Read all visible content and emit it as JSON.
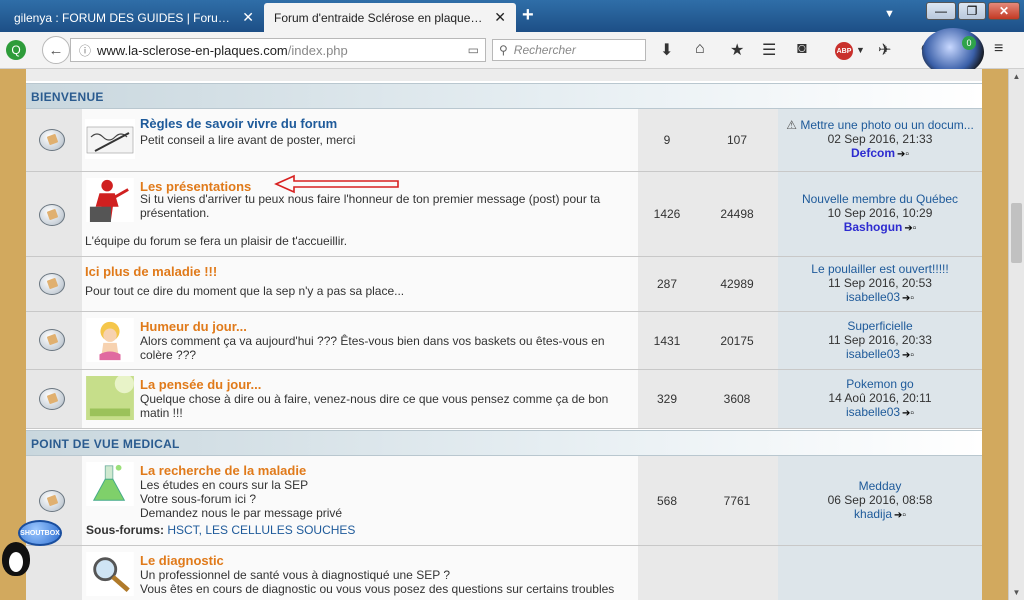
{
  "browser": {
    "tabs": [
      {
        "label": "gilenya : FORUM DES GUIDES | Forum ...",
        "active": false
      },
      {
        "label": "Forum d'entraide Sclérose en plaques (...",
        "active": true
      }
    ],
    "url_host": "www.la-sclerose-en-plaques.com",
    "url_path": "/index.php",
    "search_placeholder": "Rechercher",
    "badge_count": "0",
    "abp_label": "ABP"
  },
  "forum": {
    "top_cut_text": "…",
    "categories": [
      {
        "label": "BIENVENUE"
      },
      {
        "label": "POINT DE VUE MEDICAL"
      }
    ],
    "rows": [
      {
        "title": "Règles de savoir vivre du forum",
        "desc": "Petit conseil a lire avant de poster, merci",
        "topics": "9",
        "posts": "107",
        "last_title": "Mettre une photo ou un docum...",
        "last_date": "02 Sep 2016, 21:33",
        "last_user": "Defcom"
      },
      {
        "title": "Les présentations",
        "desc1": "Si tu viens d'arriver tu peux nous faire l'honneur de ton premier message (post) pour ta",
        "desc2": "présentation.",
        "desc3": "L'équipe du forum se fera un plaisir de t'accueillir.",
        "topics": "1426",
        "posts": "24498",
        "last_title": "Nouvelle membre du Québec",
        "last_date": "10 Sep 2016, 10:29",
        "last_user": "Bashogun"
      },
      {
        "title": "Ici plus de maladie !!!",
        "desc": "Pour tout ce dire du moment que la sep n'y a pas sa place...",
        "topics": "287",
        "posts": "42989",
        "last_title": "Le poulailler est ouvert!!!!!",
        "last_date": "11 Sep 2016, 20:53",
        "last_user": "isabelle03"
      },
      {
        "title": "Humeur du jour...",
        "desc1": "Alors comment ça va aujourd'hui ??? Êtes-vous bien dans vos baskets ou êtes-vous en",
        "desc2": "colère ???",
        "topics": "1431",
        "posts": "20175",
        "last_title": "Superficielle",
        "last_date": "11 Sep 2016, 20:33",
        "last_user": "isabelle03"
      },
      {
        "title": "La pensée du jour...",
        "desc1": "Quelque chose à dire ou à faire, venez-nous dire ce que vous pensez comme ça de bon",
        "desc2": "matin !!!",
        "topics": "329",
        "posts": "3608",
        "last_title": "Pokemon go",
        "last_date": "14 Aoû 2016, 20:11",
        "last_user": "isabelle03"
      },
      {
        "title": "La recherche de la maladie",
        "desc1": "Les études en cours sur la SEP",
        "desc2": "Votre sous-forum ici ?",
        "desc3": "Demandez nous le par message privé",
        "subforums_label": "Sous-forums:",
        "subforums": "HSCT, LES CELLULES SOUCHES",
        "topics": "568",
        "posts": "7761",
        "last_title": "Medday",
        "last_date": "06 Sep 2016, 08:58",
        "last_user": "khadija"
      },
      {
        "title": "Le diagnostic",
        "desc1": "Un professionnel de santé vous à diagnostiqué une SEP ?",
        "desc2": "Vous êtes en cours de diagnostic ou vous vous posez des questions sur certains troubles"
      }
    ]
  },
  "shoutbox_label": "SHOUTBOX",
  "colors": {
    "accent_orange": "#e07a1a",
    "link_blue": "#1e5a9a",
    "page_bg": "#d2a95e"
  }
}
